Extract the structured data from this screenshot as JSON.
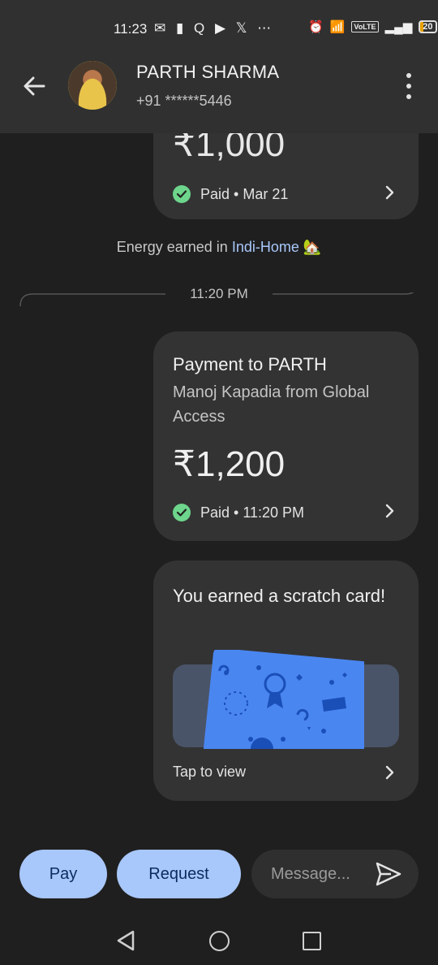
{
  "status_bar": {
    "time": "11:23",
    "left_icons": "✉ ▮ Q ▶ 𝕏 ⋯",
    "volte": "VoLTE",
    "battery": "20"
  },
  "header": {
    "name": "PARTH SHARMA",
    "phone": "+91 ******5446"
  },
  "messages": {
    "previous_payment": {
      "amount": "₹1,000",
      "status": "Paid • Mar 21"
    },
    "energy_note": {
      "prefix": "Energy earned in ",
      "link": "Indi-Home",
      "emoji": "🏡"
    },
    "time_divider": "11:20 PM",
    "payment": {
      "title": "Payment to PARTH",
      "subtitle": "Manoj Kapadia from Global Access",
      "amount": "₹1,200",
      "status": "Paid • 11:20 PM"
    },
    "scratch": {
      "title": "You earned a scratch card!",
      "action": "Tap to view"
    }
  },
  "composer": {
    "pay_label": "Pay",
    "request_label": "Request",
    "message_placeholder": "Message..."
  },
  "colors": {
    "background": "#1f1f1f",
    "header": "#303030",
    "card": "#333333",
    "accent_button": "#a8c7fa",
    "paid_green": "#6dd58c",
    "link": "#a8c7fa",
    "scratch_card": "#4285f4"
  },
  "icons": [
    "back-arrow-icon",
    "more-vert-icon",
    "check-circle-icon",
    "chevron-right-icon",
    "send-icon",
    "nav-back-icon",
    "nav-home-icon",
    "nav-recents-icon"
  ]
}
